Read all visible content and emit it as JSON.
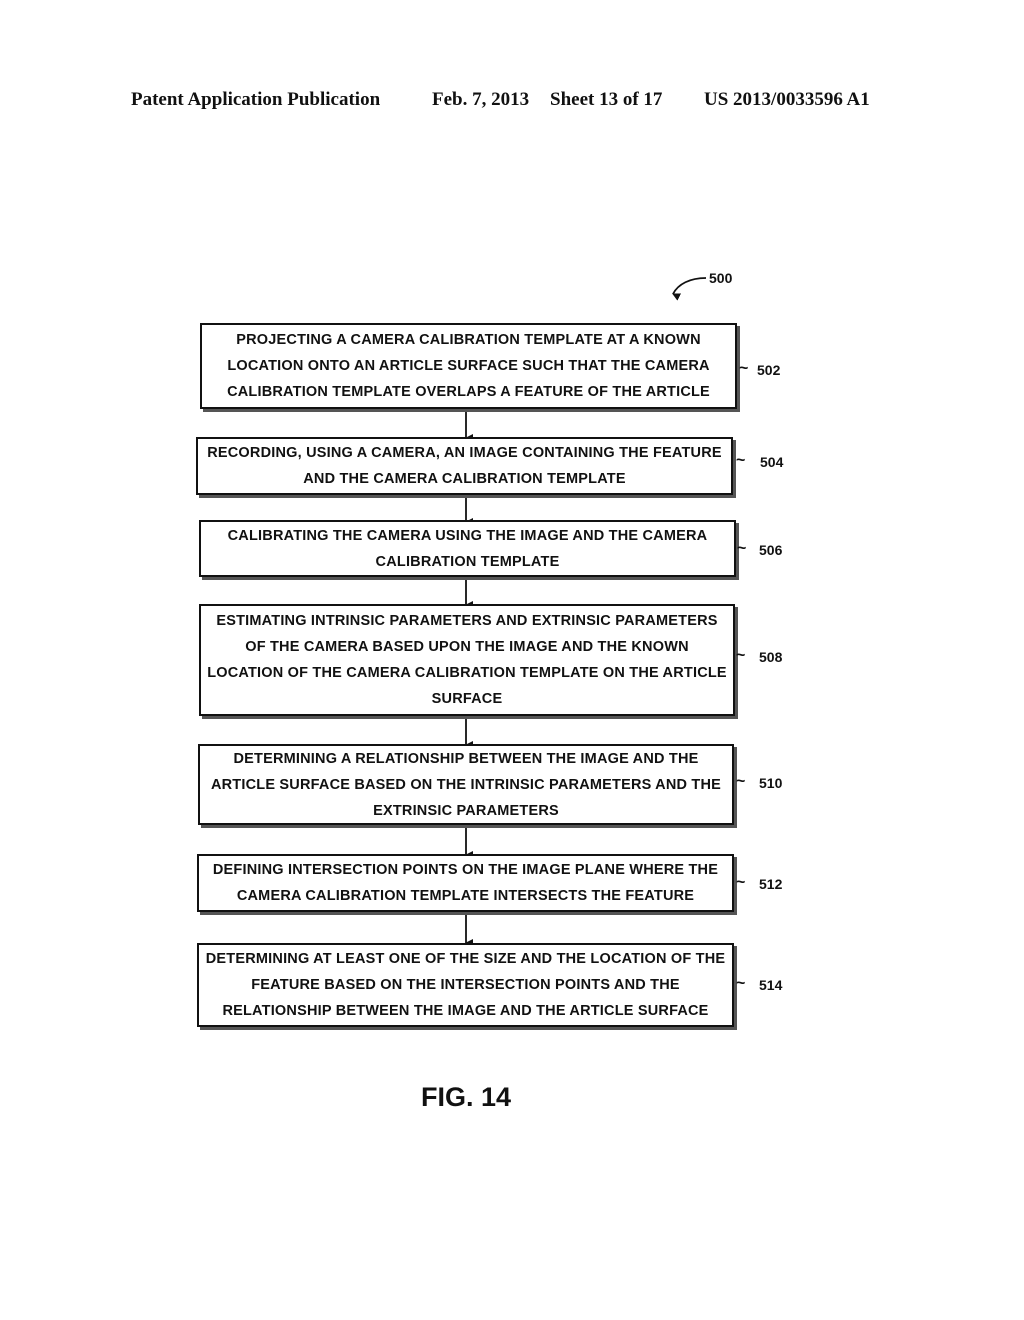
{
  "header": {
    "publication": "Patent Application Publication",
    "date": "Feb. 7, 2013",
    "sheet": "Sheet 13 of 17",
    "number": "US 2013/0033596 A1"
  },
  "figure": {
    "ref": "500",
    "label": "FIG. 14"
  },
  "steps": [
    {
      "ref": "502",
      "text": "PROJECTING A CAMERA CALIBRATION TEMPLATE AT A KNOWN LOCATION ONTO AN ARTICLE SURFACE SUCH THAT THE CAMERA CALIBRATION TEMPLATE OVERLAPS A FEATURE OF THE ARTICLE"
    },
    {
      "ref": "504",
      "text": "RECORDING, USING A CAMERA, AN IMAGE CONTAINING THE FEATURE AND THE CAMERA CALIBRATION TEMPLATE"
    },
    {
      "ref": "506",
      "text": "CALIBRATING THE CAMERA USING THE IMAGE AND THE CAMERA CALIBRATION TEMPLATE"
    },
    {
      "ref": "508",
      "text": "ESTIMATING INTRINSIC PARAMETERS AND EXTRINSIC PARAMETERS OF THE CAMERA BASED UPON THE IMAGE AND THE KNOWN LOCATION OF THE CAMERA CALIBRATION TEMPLATE ON THE ARTICLE SURFACE"
    },
    {
      "ref": "510",
      "text": "DETERMINING A RELATIONSHIP BETWEEN THE IMAGE AND THE ARTICLE SURFACE BASED ON THE INTRINSIC PARAMETERS AND THE EXTRINSIC PARAMETERS"
    },
    {
      "ref": "512",
      "text": "DEFINING INTERSECTION POINTS ON THE IMAGE PLANE WHERE THE CAMERA CALIBRATION TEMPLATE INTERSECTS THE FEATURE"
    },
    {
      "ref": "514",
      "text": "DETERMINING AT LEAST ONE OF THE SIZE AND THE LOCATION OF THE FEATURE BASED ON THE INTERSECTION POINTS AND THE RELATIONSHIP BETWEEN THE IMAGE AND THE ARTICLE SURFACE"
    }
  ]
}
